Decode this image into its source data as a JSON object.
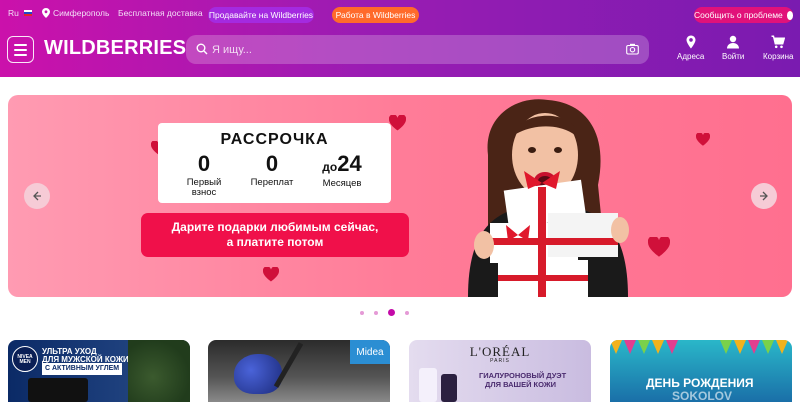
{
  "topbar": {
    "lang": "Ru",
    "city": "Симферополь",
    "delivery": "Бесплатная доставка",
    "sell_btn": "Продавайте на Wildberries",
    "work_btn": "Работа в Wildberries",
    "report_btn": "Сообщить о проблеме"
  },
  "header": {
    "logo": "WILDBERRIES",
    "search_placeholder": "Я ищу...",
    "nav": {
      "addresses": "Адреса",
      "login": "Войти",
      "cart": "Корзина"
    }
  },
  "banner": {
    "title": "РАССРОЧКА",
    "stats": [
      {
        "num": "0",
        "label_line1": "Первый",
        "label_line2": "взнос"
      },
      {
        "num": "0",
        "label_line1": "Переплат",
        "label_line2": ""
      },
      {
        "prefix": "до",
        "num": "24",
        "label_line1": "Месяцев",
        "label_line2": ""
      }
    ],
    "cta_line1": "Дарите подарки любимым сейчас,",
    "cta_line2": "а платите потом"
  },
  "carousel": {
    "dots": 4,
    "active": 2
  },
  "promos": [
    {
      "brand": "NIVEA MEN",
      "line1": "УЛЬТРА УХОД",
      "line2": "ДЛЯ МУЖСКОЙ КОЖИ",
      "line3": "С АКТИВНЫМ УГЛЕМ"
    },
    {
      "brand": "Midea"
    },
    {
      "brand": "L'ORÉAL",
      "sub": "PARIS",
      "line1": "ГИАЛУРОНОВЫЙ ДУЭТ",
      "line2": "ДЛЯ ВАШЕЙ КОЖИ"
    },
    {
      "line1": "ДЕНЬ РОЖДЕНИЯ",
      "line2": "SOKOLOV"
    }
  ],
  "colors": {
    "brand_gradient_start": "#cb11ab",
    "brand_gradient_end": "#7a1bb0",
    "cta": "#f0104a"
  }
}
